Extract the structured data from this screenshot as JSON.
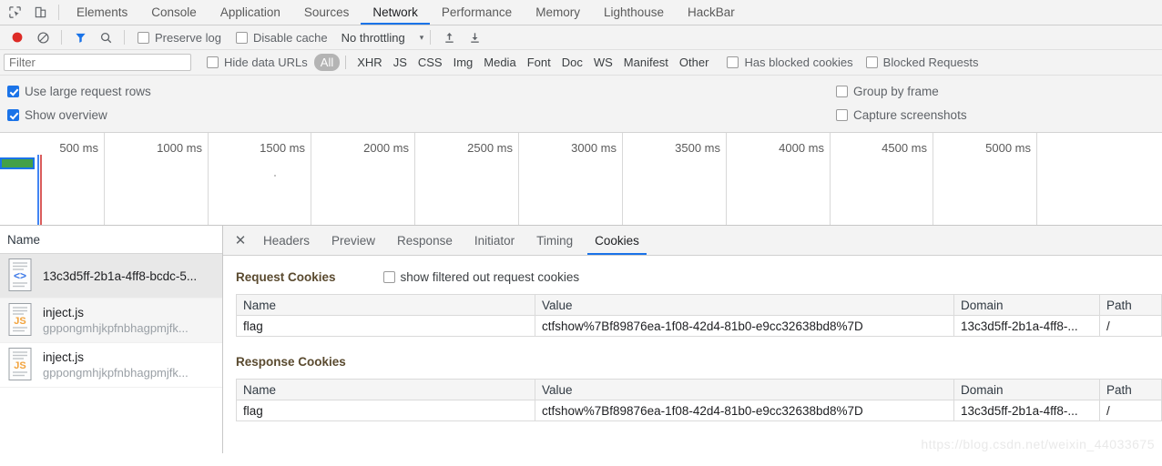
{
  "devtools": {
    "main_tabs": [
      {
        "label": "Elements",
        "active": false
      },
      {
        "label": "Console",
        "active": false
      },
      {
        "label": "Application",
        "active": false
      },
      {
        "label": "Sources",
        "active": false
      },
      {
        "label": "Network",
        "active": true
      },
      {
        "label": "Performance",
        "active": false
      },
      {
        "label": "Memory",
        "active": false
      },
      {
        "label": "Lighthouse",
        "active": false
      },
      {
        "label": "HackBar",
        "active": false
      }
    ],
    "inspect_icon": "inspect-element-icon",
    "device_icon": "device-toolbar-icon"
  },
  "toolbar": {
    "record_icon": "record-button-icon",
    "clear_icon": "clear-icon",
    "filter_icon": "filter-funnel-icon",
    "search_icon": "search-icon",
    "preserve_log": {
      "label": "Preserve log",
      "checked": false
    },
    "disable_cache": {
      "label": "Disable cache",
      "checked": false
    },
    "throttling": {
      "value": "No throttling",
      "caret": "▾"
    },
    "import_icon": "import-har-icon",
    "export_icon": "export-har-icon"
  },
  "filter": {
    "placeholder": "Filter",
    "value": "",
    "hide_data_urls": {
      "label": "Hide data URLs",
      "checked": false
    },
    "types": [
      {
        "label": "All",
        "selected": true
      },
      {
        "label": "XHR",
        "selected": false
      },
      {
        "label": "JS",
        "selected": false
      },
      {
        "label": "CSS",
        "selected": false
      },
      {
        "label": "Img",
        "selected": false
      },
      {
        "label": "Media",
        "selected": false
      },
      {
        "label": "Font",
        "selected": false
      },
      {
        "label": "Doc",
        "selected": false
      },
      {
        "label": "WS",
        "selected": false
      },
      {
        "label": "Manifest",
        "selected": false
      },
      {
        "label": "Other",
        "selected": false
      }
    ],
    "has_blocked_cookies": {
      "label": "Has blocked cookies",
      "checked": false
    },
    "blocked_requests": {
      "label": "Blocked Requests",
      "checked": false
    }
  },
  "settings": {
    "use_large_request_rows": {
      "label": "Use large request rows",
      "checked": true
    },
    "show_overview": {
      "label": "Show overview",
      "checked": true
    },
    "group_by_frame": {
      "label": "Group by frame",
      "checked": false
    },
    "capture_screenshots": {
      "label": "Capture screenshots",
      "checked": false
    }
  },
  "overview": {
    "ticks": [
      "500 ms",
      "1000 ms",
      "1500 ms",
      "2000 ms",
      "2500 ms",
      "3000 ms",
      "3500 ms",
      "4000 ms",
      "4500 ms",
      "5000 ms"
    ],
    "request_bar_color": "#43a047",
    "request_bar_border": "#1a73e8",
    "dom_content_loaded_color": "#4285f4",
    "load_event_color": "#d95c5c"
  },
  "requests": {
    "column_header": "Name",
    "rows": [
      {
        "name": "13c3d5ff-2b1a-4ff8-bcdc-5...",
        "sub": "",
        "icon": "document-file-icon",
        "selected": true
      },
      {
        "name": "inject.js",
        "sub": "gppongmhjkpfnbhagpmjfk...",
        "icon": "js-file-icon",
        "selected": false
      },
      {
        "name": "inject.js",
        "sub": "gppongmhjkpfnbhagpmjfk...",
        "icon": "js-file-icon",
        "selected": false
      }
    ]
  },
  "detail": {
    "close_label": "✕",
    "tabs": [
      {
        "label": "Headers",
        "active": false
      },
      {
        "label": "Preview",
        "active": false
      },
      {
        "label": "Response",
        "active": false
      },
      {
        "label": "Initiator",
        "active": false
      },
      {
        "label": "Timing",
        "active": false
      },
      {
        "label": "Cookies",
        "active": true
      }
    ],
    "request_cookies": {
      "title": "Request Cookies",
      "show_filtered": {
        "label": "show filtered out request cookies",
        "checked": false
      },
      "columns": [
        "Name",
        "Value",
        "Domain",
        "Path"
      ],
      "rows": [
        {
          "name": "flag",
          "value": "ctfshow%7Bf89876ea-1f08-42d4-81b0-e9cc32638bd8%7D",
          "domain": "13c3d5ff-2b1a-4ff8-...",
          "path": "/"
        }
      ]
    },
    "response_cookies": {
      "title": "Response Cookies",
      "columns": [
        "Name",
        "Value",
        "Domain",
        "Path"
      ],
      "rows": [
        {
          "name": "flag",
          "value": "ctfshow%7Bf89876ea-1f08-42d4-81b0-e9cc32638bd8%7D",
          "domain": "13c3d5ff-2b1a-4ff8-...",
          "path": "/"
        }
      ]
    }
  },
  "watermark": "https://blog.csdn.net/weixin_44033675"
}
